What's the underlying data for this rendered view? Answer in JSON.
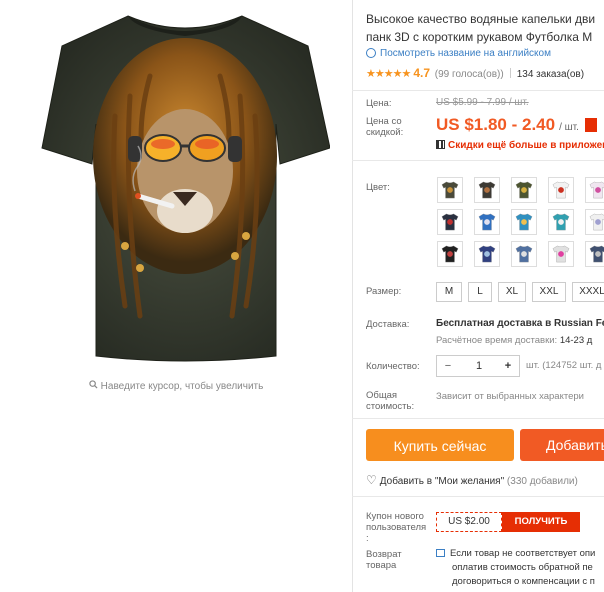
{
  "gallery": {
    "zoom_hint": "Наведите курсор, чтобы увеличить"
  },
  "product": {
    "title_line1": "Высокое качество водяные капельки дви",
    "title_line2": "панк 3D с коротким рукавом Футболка М",
    "translate_link": "Посмотреть название на английском",
    "rating": "4.7",
    "votes": "(99 голоса(ов))",
    "orders": "134 заказа(ов)"
  },
  "price": {
    "label": "Цена:",
    "old": "US $5.99 - 7.99 / шт.",
    "discount_label_1": "Цена со",
    "discount_label_2": "скидкой:",
    "new": "US $1.80 - 2.40",
    "per_unit": "/ шт.",
    "app_discount": "Скидки ещё больше в приложен"
  },
  "colors": {
    "label": "Цвет:",
    "swatches": [
      {
        "body": "#4a4a3a",
        "print": "#c8923a"
      },
      {
        "body": "#3d3a34",
        "print": "#b07040"
      },
      {
        "body": "#4d5530",
        "print": "#d6b040"
      },
      {
        "body": "#f2f2f2",
        "print": "#cc3020"
      },
      {
        "body": "#f0e6f0",
        "print": "#d050a0"
      },
      {
        "body": "#2a3040",
        "print": "#c03030"
      },
      {
        "body": "#3070c0",
        "print": "#e0e0f0"
      },
      {
        "body": "#3090c0",
        "print": "#f0c050"
      },
      {
        "body": "#30a0b0",
        "print": "#f0f0f0"
      },
      {
        "body": "#f0f0f0",
        "print": "#a0a0d0"
      },
      {
        "body": "#202020",
        "print": "#c04040"
      },
      {
        "body": "#304080",
        "print": "#a0c0e0"
      },
      {
        "body": "#5070a0",
        "print": "#e0e0e0"
      },
      {
        "body": "#e0e0e0",
        "print": "#e040a0"
      },
      {
        "body": "#405070",
        "print": "#c0c0c0"
      }
    ]
  },
  "sizes": {
    "label": "Размер:",
    "options": [
      "M",
      "L",
      "XL",
      "XXL",
      "XXXL"
    ]
  },
  "shipping": {
    "label": "Доставка:",
    "title_bold": "Бесплатная доставка",
    "title_rest": " в Russian Fe",
    "time_label": "Расчётное время доставки: ",
    "time_value": "14-23 д"
  },
  "quantity": {
    "label": "Количество:",
    "minus": "−",
    "value": "1",
    "plus": "+",
    "note": "шт. (124752 шт. д"
  },
  "total": {
    "label_1": "Общая",
    "label_2": "стоимость:",
    "note": "Зависит от выбранных характери"
  },
  "actions": {
    "buy": "Купить сейчас",
    "cart": "Добавить",
    "wish": "Добавить в \"Мои желания\"",
    "wish_count": "(330 добавили)"
  },
  "coupon": {
    "label_1": "Купон нового",
    "label_2": "пользователя",
    "label_3": ":",
    "amount": "US $2.00",
    "get": "ПОЛУЧИТЬ"
  },
  "returns": {
    "label_1": "Возврат",
    "label_2": "товара",
    "line1": "Если товар не соответствует опи",
    "line2": "оплатив стоимость обратной пе",
    "line3": "договориться о компенсации с п"
  },
  "colors_accent": {
    "price": "#f15a24",
    "buy": "#f78e1e",
    "red": "#e62e04",
    "link": "#3b7fc4"
  }
}
